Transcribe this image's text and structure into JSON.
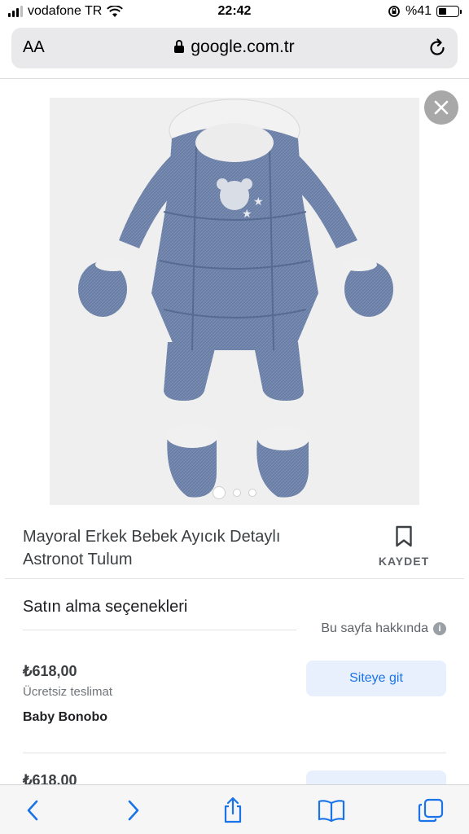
{
  "status_bar": {
    "carrier": "vodafone TR",
    "time": "22:42",
    "battery": "%41",
    "battery_fraction": 0.41
  },
  "address_bar": {
    "text_size_label": "AA",
    "url": "google.com.tr"
  },
  "product": {
    "title": "Mayoral Erkek Bebek Ayıcık Detaylı Astronot Tulum",
    "save_label": "KAYDET",
    "image_count": 3,
    "active_image": 1
  },
  "purchase": {
    "heading": "Satın alma seçenekleri",
    "about_link": "Bu sayfa hakkında",
    "offers": [
      {
        "price": "₺618,00",
        "shipping": "Ücretsiz teslimat",
        "seller": "Baby Bonobo",
        "button_label": "Siteye git"
      },
      {
        "price": "₺618,00"
      }
    ]
  },
  "icons": [
    "wifi-icon",
    "lock-icon",
    "reload-icon",
    "close-icon",
    "bookmark-icon",
    "info-icon",
    "back-icon",
    "forward-icon",
    "share-icon",
    "bookmarks-icon",
    "tabs-icon"
  ],
  "colors": {
    "accent": "#1a73e8",
    "button_bg": "#e8f0fe",
    "garment": "#6b7fa6"
  }
}
